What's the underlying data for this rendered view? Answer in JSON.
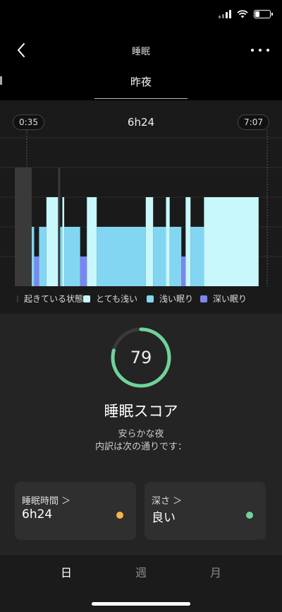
{
  "status_bar": {
    "battery_level": 0.3,
    "icons": [
      "cellular-signal-icon",
      "wifi-icon",
      "battery-icon"
    ]
  },
  "nav": {
    "title": "睡眠",
    "back_icon": "chevron-left-icon",
    "more_icon": "more-horizontal-icon"
  },
  "tabs": {
    "active_label": "昨夜"
  },
  "chart": {
    "start_time": "0:35",
    "end_time": "7:07",
    "duration": "6h24",
    "legend": [
      {
        "label": "起きている状態",
        "color": "#3a3a3a"
      },
      {
        "label": "とても浅い",
        "color": "#c8f8fb"
      },
      {
        "label": "浅い眠り",
        "color": "#82d6f2"
      },
      {
        "label": "深い眠り",
        "color": "#7c86f2"
      }
    ]
  },
  "chart_data": {
    "type": "bar",
    "title": "",
    "x_start": "0:35",
    "x_end": "7:07",
    "stage_levels": {
      "深い眠り": 1,
      "浅い眠り": 2,
      "とても浅い": 3,
      "起きている状態": 4
    },
    "segments": [
      {
        "stage": "起きている状態",
        "start": "0:35",
        "end": "0:43"
      },
      {
        "stage": "浅い眠り",
        "start": "0:43",
        "end": "0:47"
      },
      {
        "stage": "深い眠り",
        "start": "0:47",
        "end": "0:55"
      },
      {
        "stage": "浅い眠り",
        "start": "0:55",
        "end": "1:07"
      },
      {
        "stage": "とても浅い",
        "start": "1:07",
        "end": "1:26"
      },
      {
        "stage": "起きている状態",
        "start": "1:26",
        "end": "1:28"
      },
      {
        "stage": "浅い眠り",
        "start": "1:28",
        "end": "1:33"
      },
      {
        "stage": "とても浅い",
        "start": "1:33",
        "end": "1:36"
      },
      {
        "stage": "浅い眠り",
        "start": "1:36",
        "end": "2:02"
      },
      {
        "stage": "深い眠り",
        "start": "2:02",
        "end": "2:13"
      },
      {
        "stage": "とても浅い",
        "start": "2:13",
        "end": "2:29"
      },
      {
        "stage": "浅い眠り",
        "start": "2:29",
        "end": "3:49"
      },
      {
        "stage": "とても浅い",
        "start": "3:49",
        "end": "4:01"
      },
      {
        "stage": "浅い眠り",
        "start": "4:01",
        "end": "4:22"
      },
      {
        "stage": "とても浅い",
        "start": "4:22",
        "end": "4:28"
      },
      {
        "stage": "浅い眠り",
        "start": "4:28",
        "end": "4:47"
      },
      {
        "stage": "深い眠り",
        "start": "4:47",
        "end": "4:54"
      },
      {
        "stage": "とても浅い",
        "start": "4:54",
        "end": "5:02"
      },
      {
        "stage": "浅い眠り",
        "start": "5:02",
        "end": "5:24"
      },
      {
        "stage": "とても浅い",
        "start": "5:24",
        "end": "6:53"
      }
    ]
  },
  "score": {
    "value": "79",
    "progress": 0.79,
    "ring_color": "#6fd39a",
    "title": "睡眠スコア",
    "line1": "安らかな夜",
    "line2": "内訳は次の通りです："
  },
  "cards": [
    {
      "title": "睡眠時間 ＞",
      "value": "6h24",
      "dot_color": "#f6b54a"
    },
    {
      "title": "深さ ＞",
      "value": "良い",
      "dot_color": "#6fd39a"
    }
  ],
  "bottom_tabs": [
    {
      "label": "日",
      "active": true
    },
    {
      "label": "週",
      "active": false
    },
    {
      "label": "月",
      "active": false
    }
  ]
}
